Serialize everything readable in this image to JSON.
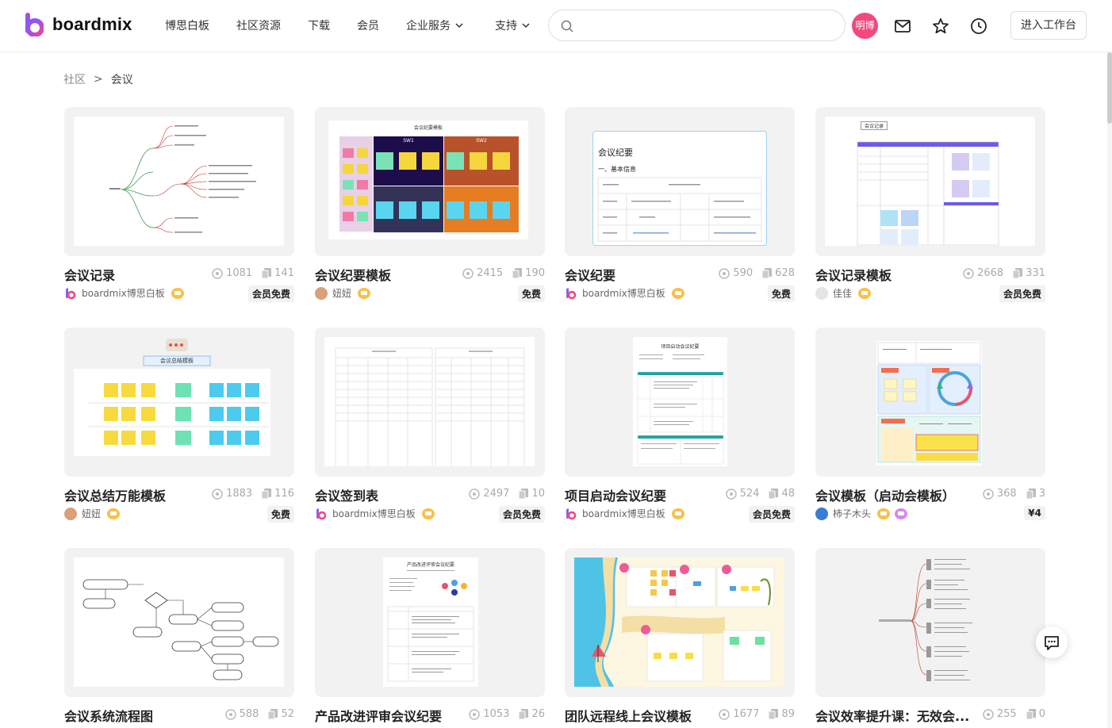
{
  "header": {
    "logo_text": "boardmix",
    "nav": [
      {
        "label": "博思白板"
      },
      {
        "label": "社区资源"
      },
      {
        "label": "下载"
      },
      {
        "label": "会员"
      },
      {
        "label": "企业服务"
      },
      {
        "label": "支持"
      }
    ],
    "search_placeholder": "",
    "avatar_text": "明博",
    "workspace_button": "进入工作台",
    "accent_color": "#f2497c"
  },
  "breadcrumb": {
    "root": "社区",
    "separator": ">",
    "current": "会议"
  },
  "cards": [
    {
      "title": "会议记录",
      "views": "1081",
      "copies": "141",
      "author": "boardmix博思白板",
      "price": "会员免费"
    },
    {
      "title": "会议纪要模板",
      "views": "2415",
      "copies": "190",
      "author": "妞妞",
      "price": "免费"
    },
    {
      "title": "会议纪要",
      "views": "590",
      "copies": "628",
      "author": "boardmix博思白板",
      "price": "免费"
    },
    {
      "title": "会议记录模板",
      "views": "2668",
      "copies": "331",
      "author": "佳佳",
      "price": "会员免费"
    },
    {
      "title": "会议总结万能模板",
      "views": "1883",
      "copies": "116",
      "author": "妞妞",
      "price": "免费"
    },
    {
      "title": "会议签到表",
      "views": "2497",
      "copies": "10",
      "author": "boardmix博思白板",
      "price": "会员免费"
    },
    {
      "title": "项目启动会议纪要",
      "views": "524",
      "copies": "48",
      "author": "boardmix博思白板",
      "price": "会员免费"
    },
    {
      "title": "会议模板（启动会模板）",
      "views": "368",
      "copies": "3",
      "author": "柿子木头",
      "price": "¥4"
    },
    {
      "title": "会议系统流程图",
      "views": "588",
      "copies": "52",
      "author": "",
      "price": ""
    },
    {
      "title": "产品改进评审会议纪要",
      "views": "1053",
      "copies": "26",
      "author": "",
      "price": ""
    },
    {
      "title": "团队远程线上会议模板",
      "views": "1677",
      "copies": "89",
      "author": "",
      "price": ""
    },
    {
      "title": "会议效率提升课：无效会...",
      "views": "255",
      "copies": "0",
      "author": "",
      "price": ""
    }
  ],
  "thumb_text": {
    "t2_title": "会议纪要模板",
    "t2_c1": "SW1",
    "t2_c2": "SW2",
    "t3_title": "会议纪要",
    "t3_section": "一、基本信息",
    "t4_header": "会议记录",
    "t5_title": "会议总结模板",
    "t7_title": "项目启动会议纪要",
    "t10_title": "产品改进评审会议纪要"
  },
  "icons": {
    "views": "eye-icon",
    "copies": "copy-icon",
    "search": "search-icon",
    "mail": "mail-icon",
    "star": "star-icon",
    "history": "clock-icon",
    "chat": "chat-icon"
  }
}
